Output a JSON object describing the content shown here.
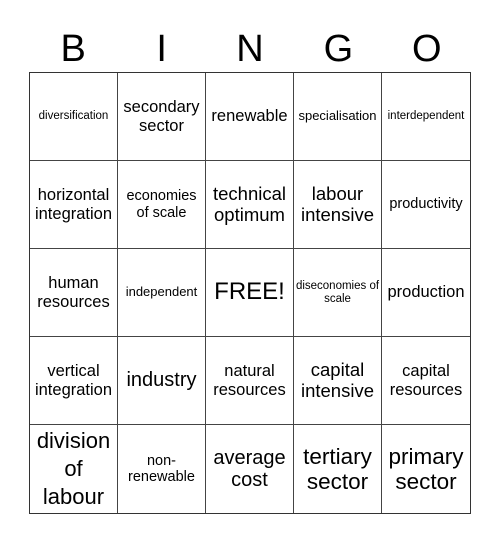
{
  "header": {
    "letters": [
      "B",
      "I",
      "N",
      "G",
      "O"
    ]
  },
  "cells": [
    "diversification",
    "secondary sector",
    "renewable",
    "specialisation",
    "interdependent",
    "horizontal integration",
    "economies of scale",
    "technical optimum",
    "labour intensive",
    "productivity",
    "human resources",
    "independent",
    "FREE!",
    "diseconomies of scale",
    "production",
    "vertical integration",
    "industry",
    "natural resources",
    "capital intensive",
    "capital resources",
    "division of labour",
    "non-renewable",
    "average cost",
    "tertiary sector",
    "primary sector"
  ]
}
